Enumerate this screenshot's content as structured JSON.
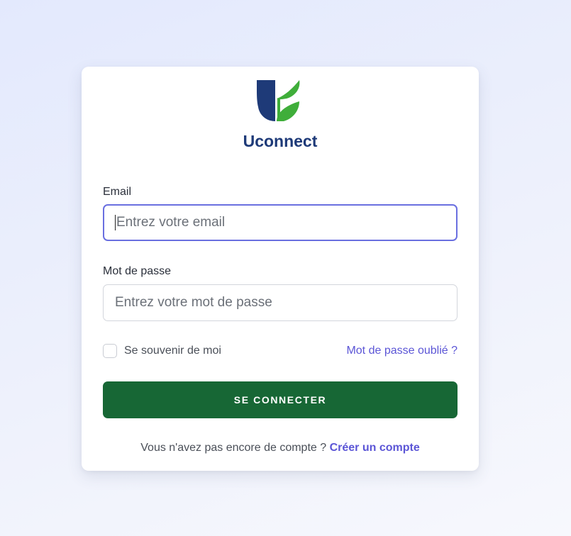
{
  "brand": {
    "name": "Uconnect",
    "logo_icon": "shield-leaf-logo-icon",
    "colors": {
      "navy": "#1e3a78",
      "green": "#3fae3a"
    }
  },
  "form": {
    "email": {
      "label": "Email",
      "placeholder": "Entrez votre email",
      "value": ""
    },
    "password": {
      "label": "Mot de passe",
      "placeholder": "Entrez votre mot de passe",
      "value": ""
    },
    "remember_label": "Se souvenir de moi",
    "remember_checked": false,
    "forgot_link": "Mot de passe oublié ?",
    "submit_label": "SE CONNECTER"
  },
  "footer": {
    "text": "Vous n'avez pas encore de compte ?",
    "link": "Créer un compte"
  },
  "colors": {
    "primary_button": "#176735",
    "link": "#5b55d6",
    "focus_border": "#6a6fe0"
  }
}
